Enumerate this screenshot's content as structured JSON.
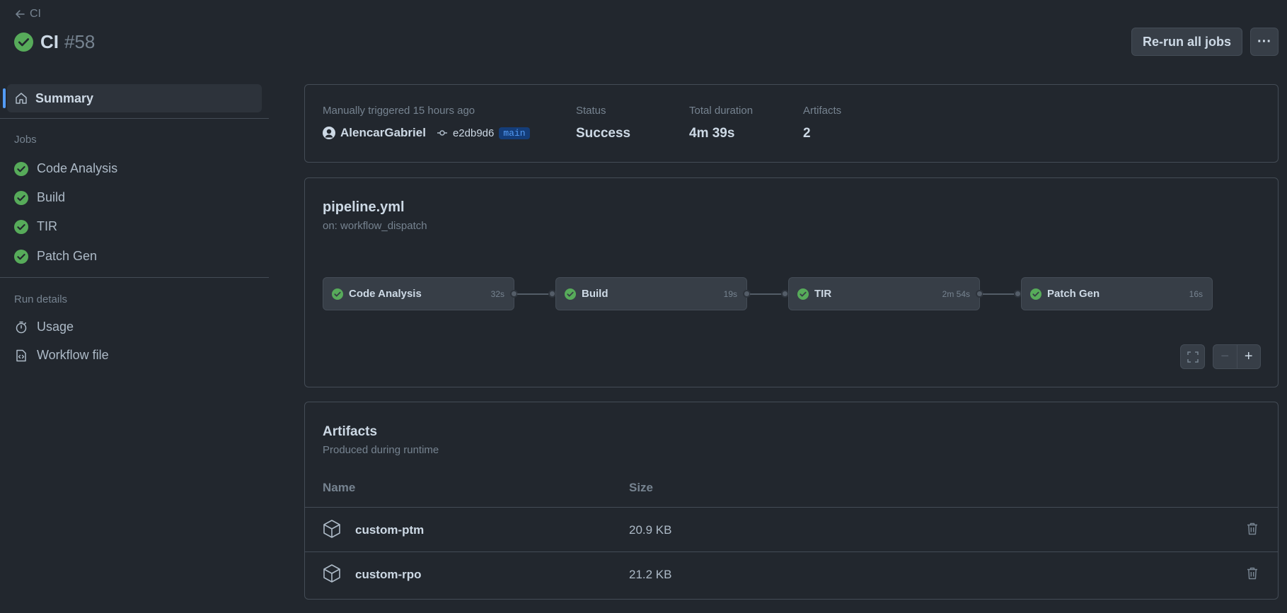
{
  "header": {
    "back_label": "CI",
    "title": "CI",
    "run_number": "#58",
    "rerun_label": "Re-run all jobs",
    "more_label": "···"
  },
  "sidebar": {
    "summary_label": "Summary",
    "jobs_heading": "Jobs",
    "jobs": [
      {
        "label": "Code Analysis",
        "status": "success"
      },
      {
        "label": "Build",
        "status": "success"
      },
      {
        "label": "TIR",
        "status": "success"
      },
      {
        "label": "Patch Gen",
        "status": "success"
      }
    ],
    "run_details_heading": "Run details",
    "usage_label": "Usage",
    "workflow_file_label": "Workflow file"
  },
  "summary": {
    "trigger_label": "Manually triggered 15 hours ago",
    "actor": "AlencarGabriel",
    "commit": "e2db9d6",
    "branch": "main",
    "status_label": "Status",
    "status_value": "Success",
    "duration_label": "Total duration",
    "duration_value": "4m 39s",
    "artifacts_label": "Artifacts",
    "artifacts_value": "2"
  },
  "pipeline": {
    "filename": "pipeline.yml",
    "trigger": "on: workflow_dispatch",
    "nodes": [
      {
        "label": "Code Analysis",
        "duration": "32s"
      },
      {
        "label": "Build",
        "duration": "19s"
      },
      {
        "label": "TIR",
        "duration": "2m 54s"
      },
      {
        "label": "Patch Gen",
        "duration": "16s"
      }
    ],
    "zoom_out": "−",
    "zoom_in": "+"
  },
  "artifacts": {
    "title": "Artifacts",
    "subtitle": "Produced during runtime",
    "col_name": "Name",
    "col_size": "Size",
    "rows": [
      {
        "name": "custom-ptm",
        "size": "20.9 KB"
      },
      {
        "name": "custom-rpo",
        "size": "21.2 KB"
      }
    ]
  },
  "colors": {
    "success": "#57ab5a",
    "accent": "#539bf5",
    "background": "#22272e"
  }
}
